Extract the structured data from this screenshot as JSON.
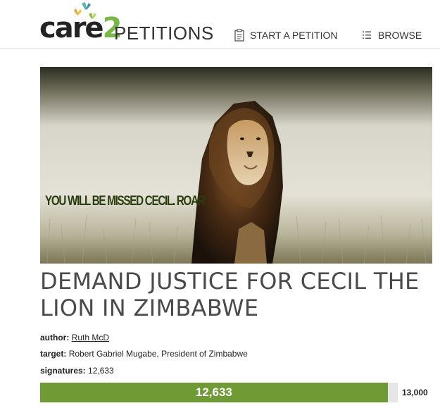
{
  "header": {
    "logo_care": "care",
    "logo_two": "2",
    "logo_petitions": "PETITIONS",
    "nav": [
      {
        "label": "START A PETITION",
        "icon": "clipboard-icon"
      },
      {
        "label": "BROWSE",
        "icon": "list-icon"
      }
    ]
  },
  "hero": {
    "caption": "YOU WILL BE MISSED CECIL. ROAR",
    "subject": "lion"
  },
  "petition": {
    "title": "DEMAND JUSTICE FOR CECIL THE LION IN ZIMBABWE",
    "author_label": "author:",
    "author": "Ruth McD",
    "target_label": "target:",
    "target": "Robert Gabriel Mugabe, President of Zimbabwe",
    "signatures_label": "signatures:",
    "signatures": "12,633"
  },
  "progress": {
    "current": 12633,
    "current_label": "12,633",
    "goal": 13000,
    "goal_label": "13,000",
    "fill_fraction": 0.972,
    "fill_color": "#6f9a35"
  },
  "colors": {
    "brand_green": "#7ab648",
    "text_dark": "#232323",
    "title_gray": "#4a4a4a"
  }
}
